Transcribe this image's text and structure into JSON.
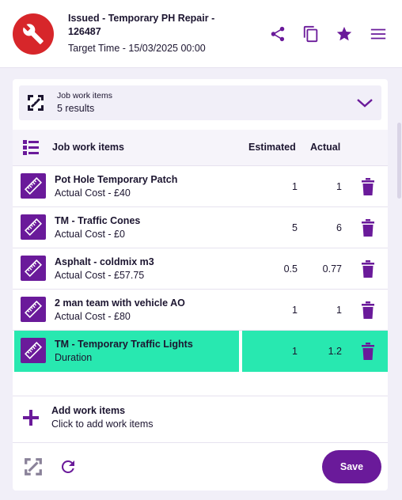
{
  "header": {
    "title": "Issued - Temporary PH Repair - 126487",
    "target_time": "Target Time - 15/03/2025 00:00",
    "icons": [
      "share-icon",
      "copy-icon",
      "star-icon",
      "menu-icon"
    ]
  },
  "filter": {
    "label": "Job work items",
    "count": "5 results"
  },
  "table": {
    "headers": {
      "name": "Job work items",
      "estimated": "Estimated",
      "actual": "Actual"
    },
    "rows": [
      {
        "name": "Pot Hole Temporary Patch",
        "sub": "Actual Cost - £40",
        "estimated": "1",
        "actual": "1",
        "selected": false
      },
      {
        "name": "TM - Traffic Cones",
        "sub": "Actual Cost - £0",
        "estimated": "5",
        "actual": "6",
        "selected": false
      },
      {
        "name": "Asphalt - coldmix m3",
        "sub": "Actual Cost - £57.75",
        "estimated": "0.5",
        "actual": "0.77",
        "selected": false
      },
      {
        "name": "2 man team with vehicle AO",
        "sub": "Actual Cost - £80",
        "estimated": "1",
        "actual": "1",
        "selected": false
      },
      {
        "name": "TM - Temporary Traffic Lights",
        "sub": "Duration",
        "estimated": "1",
        "actual": "1.2",
        "selected": true
      }
    ]
  },
  "add": {
    "title": "Add work items",
    "subtitle": "Click to add work items"
  },
  "footer": {
    "save_label": "Save"
  },
  "colors": {
    "brand": "#6a1a9a",
    "logo": "#d7262a",
    "selected": "#28e8b0",
    "background": "#f1eff8"
  }
}
